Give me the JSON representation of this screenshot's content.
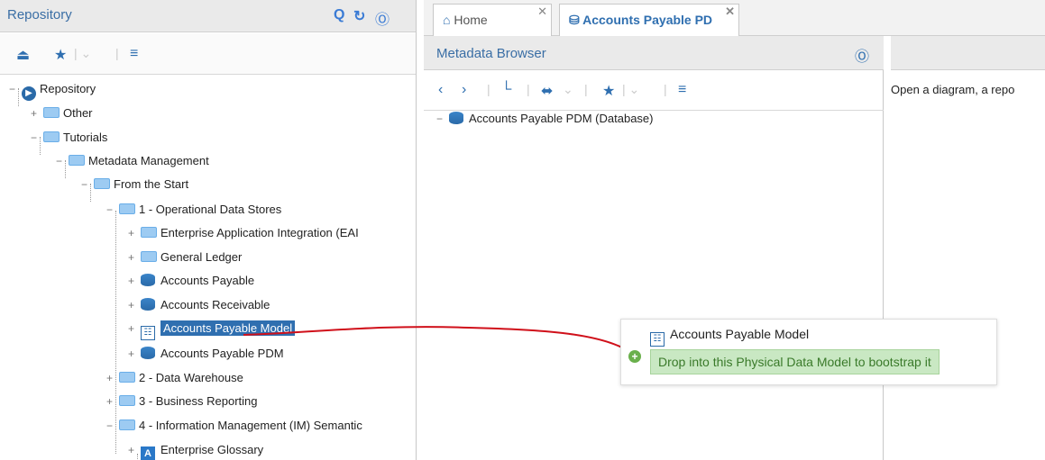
{
  "repository": {
    "title": "Repository",
    "icons": [
      "search-icon",
      "refresh-icon",
      "collapse-icon"
    ],
    "toolbar": [
      "import-icon",
      "favorite-icon",
      "menu-icon"
    ],
    "tree": [
      {
        "label": "Repository",
        "level": 0,
        "icon": "repository"
      },
      {
        "label": "Other",
        "level": 1,
        "icon": "folder"
      },
      {
        "label": "Tutorials",
        "level": 1,
        "icon": "folder"
      },
      {
        "label": "Metadata Management",
        "level": 2,
        "icon": "folder"
      },
      {
        "label": "From the Start",
        "level": 3,
        "icon": "folder"
      },
      {
        "label": "1 - Operational Data Stores",
        "level": 4,
        "icon": "folder"
      },
      {
        "label": "Enterprise Application Integration (EAI",
        "level": 5,
        "icon": "folder"
      },
      {
        "label": "General Ledger",
        "level": 5,
        "icon": "folder"
      },
      {
        "label": "Accounts Payable",
        "level": 5,
        "icon": "database"
      },
      {
        "label": "Accounts Receivable",
        "level": 5,
        "icon": "database"
      },
      {
        "label": "Accounts Payable Model",
        "level": 5,
        "icon": "model",
        "selected": true
      },
      {
        "label": "Accounts Payable PDM",
        "level": 5,
        "icon": "database"
      },
      {
        "label": "2 - Data Warehouse",
        "level": 4,
        "icon": "folder"
      },
      {
        "label": "3 - Business Reporting",
        "level": 4,
        "icon": "folder"
      },
      {
        "label": "4 - Information Management (IM) Semantic",
        "level": 4,
        "icon": "folder"
      },
      {
        "label": "Enterprise Glossary",
        "level": 5,
        "icon": "glossary"
      }
    ]
  },
  "tabs": [
    {
      "label": "Home",
      "icon": "home-icon"
    },
    {
      "label": "Accounts Payable PD",
      "icon": "database-icon"
    }
  ],
  "metadata_browser": {
    "title": "Metadata Browser",
    "root_item": "Accounts Payable PDM (Database)"
  },
  "right_panel": {
    "text": "Open a diagram, a repo"
  },
  "drag_tooltip": {
    "title": "Accounts Payable Model",
    "hint": "Drop into this Physical Data Model to bootstrap it"
  },
  "colors": {
    "accent": "#2f6fb0",
    "drag_line": "#d0101a",
    "hint_bg": "#c9e8c3"
  }
}
